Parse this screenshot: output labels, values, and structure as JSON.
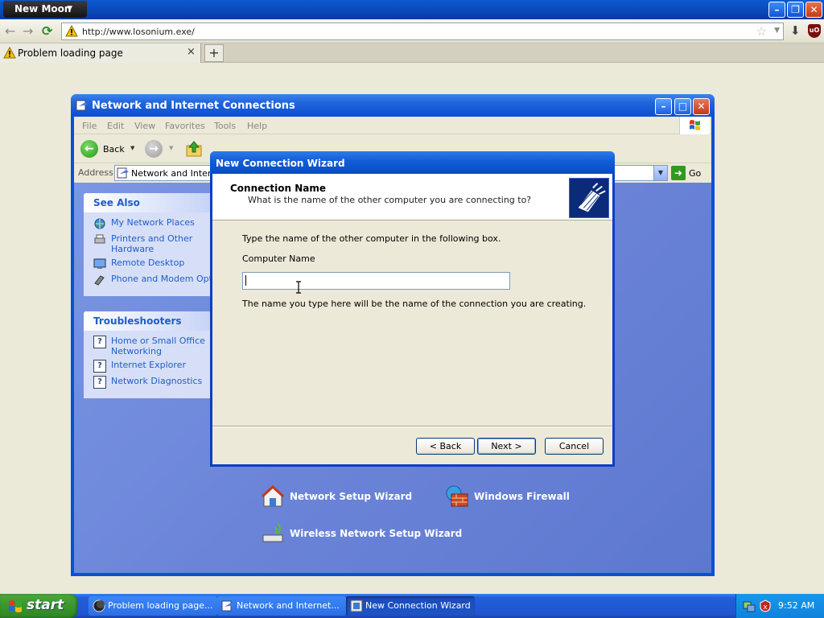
{
  "browser": {
    "app_menu": "New Moon",
    "url": "http://www.losonium.exe/",
    "tab_label": "Problem loading page",
    "tab_close": "×",
    "new_tab": "+",
    "controls": {
      "minimize": "–",
      "restore": "❐",
      "close": "✕"
    },
    "nav": {
      "back": "←",
      "forward": "→",
      "reload": "⟳"
    }
  },
  "explorer": {
    "title": "Network and Internet Connections",
    "menu": [
      "File",
      "Edit",
      "View",
      "Favorites",
      "Tools",
      "Help"
    ],
    "toolbar": {
      "back_label": "Back"
    },
    "address_label": "Address",
    "address_value": "Network and Internet Connections",
    "go_label": "Go",
    "see_also": {
      "title": "See Also",
      "items": [
        "My Network Places",
        "Printers and Other Hardware",
        "Remote Desktop",
        "Phone and Modem Options"
      ]
    },
    "troubleshooters": {
      "title": "Troubleshooters",
      "items": [
        "Home or Small Office Networking",
        "Internet Explorer",
        "Network Diagnostics"
      ]
    },
    "tasks": [
      "Network Setup Wizard",
      "Windows Firewall",
      "Wireless Network Setup Wizard"
    ]
  },
  "wizard": {
    "title": "New Connection Wizard",
    "header_title": "Connection Name",
    "header_subtitle": "What is the name of the other computer you are connecting to?",
    "instruction": "Type the name of the other computer in the following box.",
    "field_label": "Computer Name",
    "field_value": "",
    "note": "The name you type here will be the name of the connection you are creating.",
    "buttons": {
      "back": "< Back",
      "next": "Next >",
      "cancel": "Cancel"
    }
  },
  "taskbar": {
    "start": "start",
    "tasks": [
      "Problem loading page...",
      "Network and Internet...",
      "New Connection Wizard"
    ],
    "active_task": 2,
    "clock": "9:52 AM"
  },
  "colors": {
    "xp_blue": "#0a4fd0",
    "link_blue": "#215dc6",
    "panel_bg": "#d6dff7",
    "start_green": "#3c9a2f"
  }
}
